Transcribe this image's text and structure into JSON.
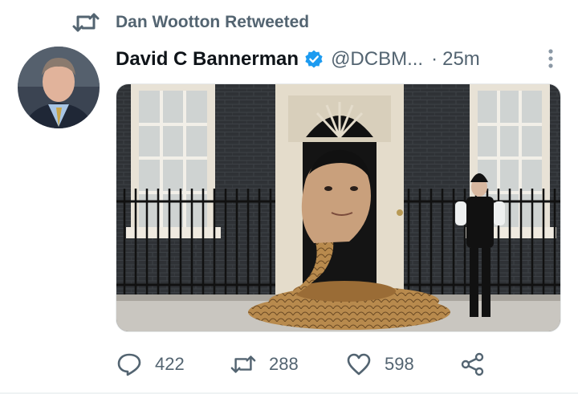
{
  "retweet": {
    "icon": "retweet-icon",
    "text": "Dan Wootton Retweeted"
  },
  "tweet": {
    "author_name": "David C Bannerman",
    "verified_icon": "verified-badge-icon",
    "handle": "@DCBM...",
    "separator": "·",
    "time": "25m",
    "more_icon": "more-options-icon",
    "media_alt": "photo"
  },
  "actions": {
    "reply": {
      "icon": "reply-icon",
      "count": "422"
    },
    "retweet": {
      "icon": "retweet-icon",
      "count": "288"
    },
    "like": {
      "icon": "heart-icon",
      "count": "598"
    },
    "share": {
      "icon": "share-icon"
    }
  },
  "colors": {
    "text_primary": "#0f1419",
    "text_secondary": "#536471",
    "verified_blue": "#1d9bf0"
  }
}
